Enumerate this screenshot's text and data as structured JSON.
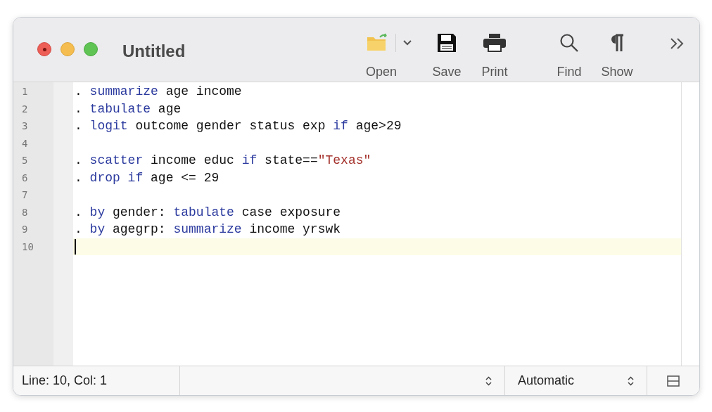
{
  "window": {
    "title": "Untitled"
  },
  "toolbar": [
    {
      "label": "Open",
      "kind": "open"
    },
    {
      "label": "Save",
      "kind": "save"
    },
    {
      "label": "Print",
      "kind": "print"
    },
    {
      "label": "Find",
      "kind": "find"
    },
    {
      "label": "Show",
      "kind": "show"
    }
  ],
  "editor": {
    "lines": [
      {
        "number": "1",
        "current": false,
        "tokens": [
          {
            "kind": "plain",
            "text": ". "
          },
          {
            "kind": "keyword",
            "text": "summarize"
          },
          {
            "kind": "plain",
            "text": " age income"
          }
        ]
      },
      {
        "number": "2",
        "current": false,
        "tokens": [
          {
            "kind": "plain",
            "text": ". "
          },
          {
            "kind": "keyword",
            "text": "tabulate"
          },
          {
            "kind": "plain",
            "text": " age"
          }
        ]
      },
      {
        "number": "3",
        "current": false,
        "tokens": [
          {
            "kind": "plain",
            "text": ". "
          },
          {
            "kind": "keyword",
            "text": "logit"
          },
          {
            "kind": "plain",
            "text": " outcome gender status exp "
          },
          {
            "kind": "keyword",
            "text": "if"
          },
          {
            "kind": "plain",
            "text": " age>29"
          }
        ]
      },
      {
        "number": "4",
        "current": false
      },
      {
        "number": "5",
        "current": false,
        "tokens": [
          {
            "kind": "plain",
            "text": ". "
          },
          {
            "kind": "keyword",
            "text": "scatter"
          },
          {
            "kind": "plain",
            "text": " income educ "
          },
          {
            "kind": "keyword",
            "text": "if"
          },
          {
            "kind": "plain",
            "text": " state=="
          },
          {
            "kind": "string",
            "text": "\"Texas\""
          }
        ]
      },
      {
        "number": "6",
        "current": false,
        "tokens": [
          {
            "kind": "plain",
            "text": ". "
          },
          {
            "kind": "keyword",
            "text": "drop if"
          },
          {
            "kind": "plain",
            "text": " age <= 29"
          }
        ]
      },
      {
        "number": "7",
        "current": false
      },
      {
        "number": "8",
        "current": false,
        "tokens": [
          {
            "kind": "plain",
            "text": ". "
          },
          {
            "kind": "keyword",
            "text": "by"
          },
          {
            "kind": "plain",
            "text": " gender: "
          },
          {
            "kind": "keyword",
            "text": "tabulate"
          },
          {
            "kind": "plain",
            "text": " case exposure"
          }
        ]
      },
      {
        "number": "9",
        "current": false,
        "tokens": [
          {
            "kind": "plain",
            "text": ". "
          },
          {
            "kind": "keyword",
            "text": "by"
          },
          {
            "kind": "plain",
            "text": " agegrp: "
          },
          {
            "kind": "keyword",
            "text": "summarize"
          },
          {
            "kind": "plain",
            "text": " income yrswk"
          }
        ]
      },
      {
        "number": "10",
        "current": true
      }
    ]
  },
  "status_bar": {
    "position": "Line: 10, Col: 1",
    "encoding": "Automatic"
  }
}
